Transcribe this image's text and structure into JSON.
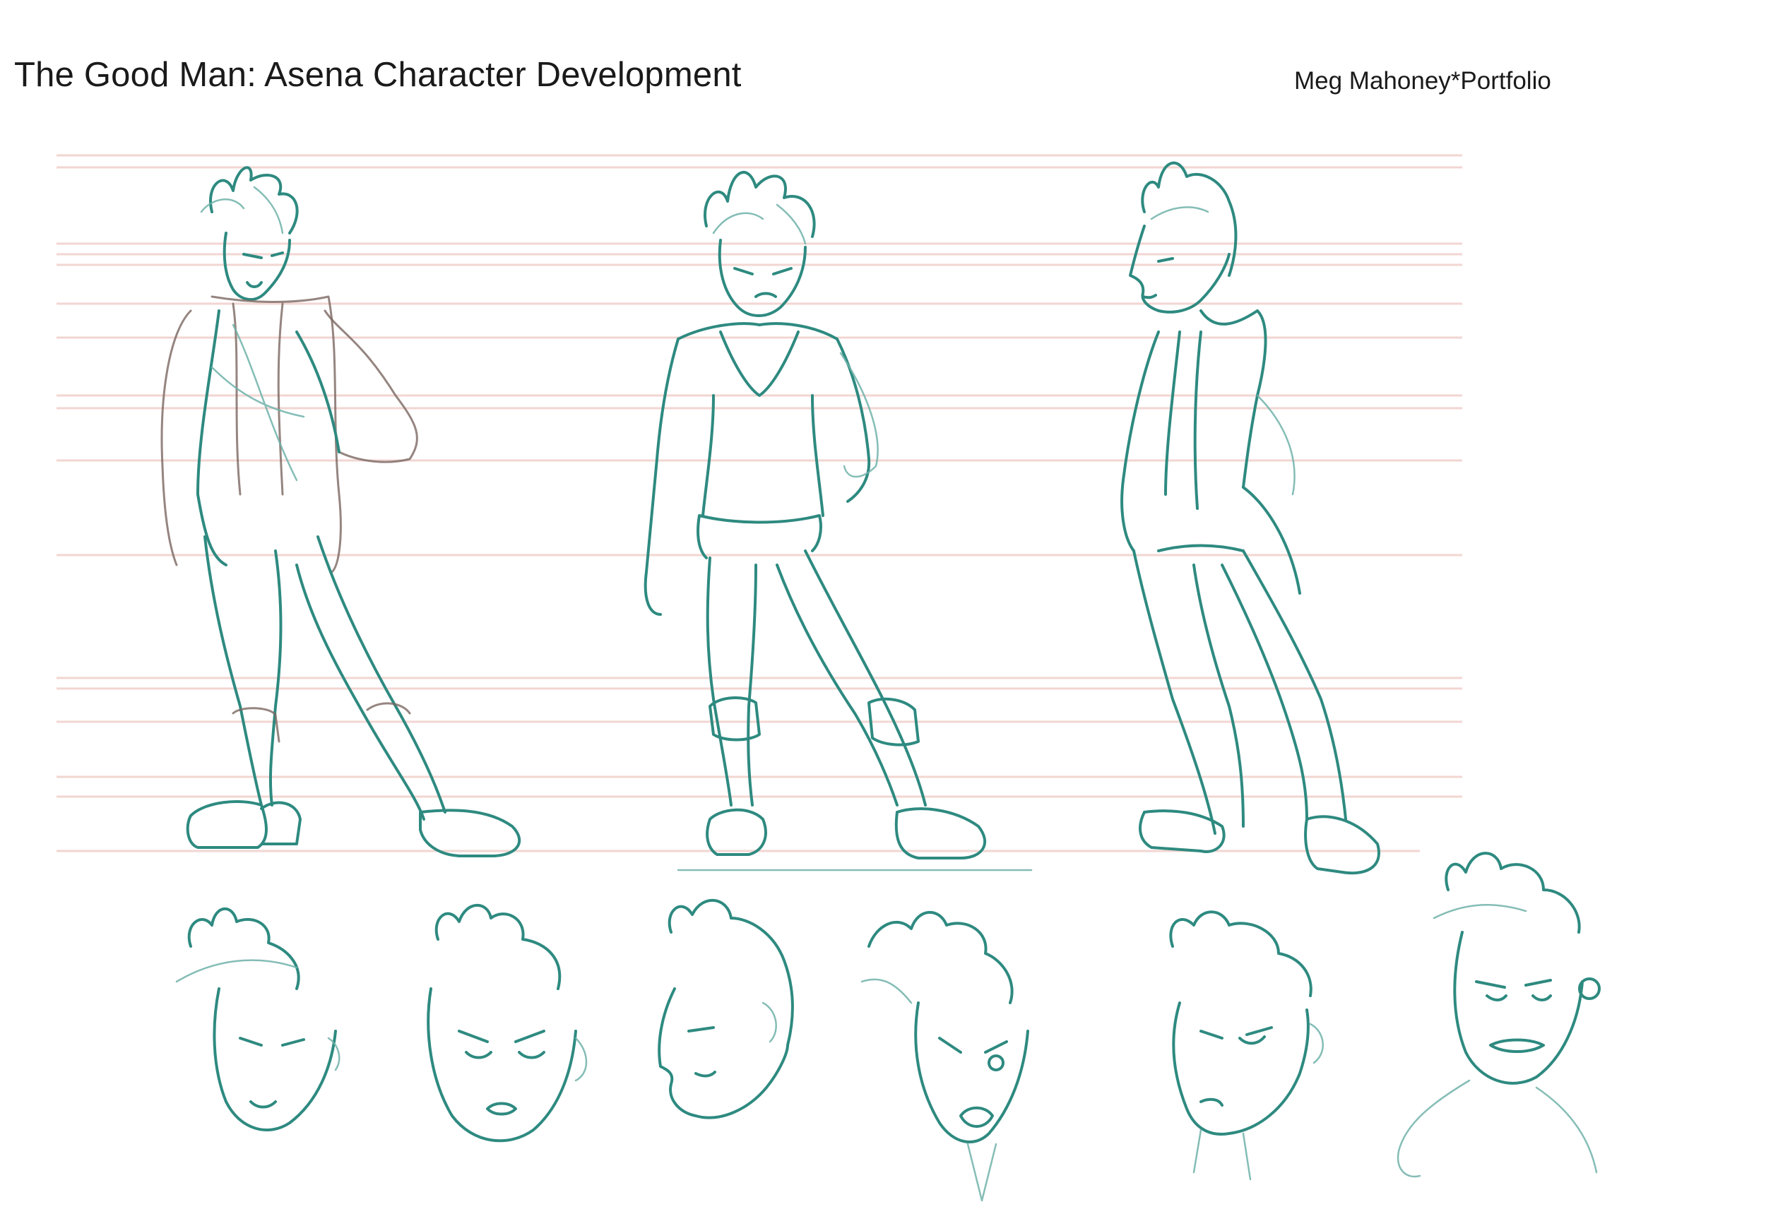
{
  "sheet": {
    "title": "The Good Man: Asena Character Development",
    "credit": "Meg Mahoney*Portfolio"
  },
  "colors": {
    "background": "#ffffff",
    "sketch_ink": "#2e8a80",
    "sketch_light": "#6fb2a9",
    "underdrawing": "#7a6660",
    "guide_lines": "#f2d6d2",
    "text": "#1a1a1a"
  },
  "figures": [
    {
      "name": "full-body-pose-three-quarter"
    },
    {
      "name": "full-body-pose-front"
    },
    {
      "name": "full-body-pose-side"
    }
  ],
  "heads": [
    {
      "name": "head-study-1"
    },
    {
      "name": "head-study-2"
    },
    {
      "name": "head-study-3"
    },
    {
      "name": "head-study-4"
    },
    {
      "name": "head-study-5"
    },
    {
      "name": "head-study-6"
    }
  ]
}
